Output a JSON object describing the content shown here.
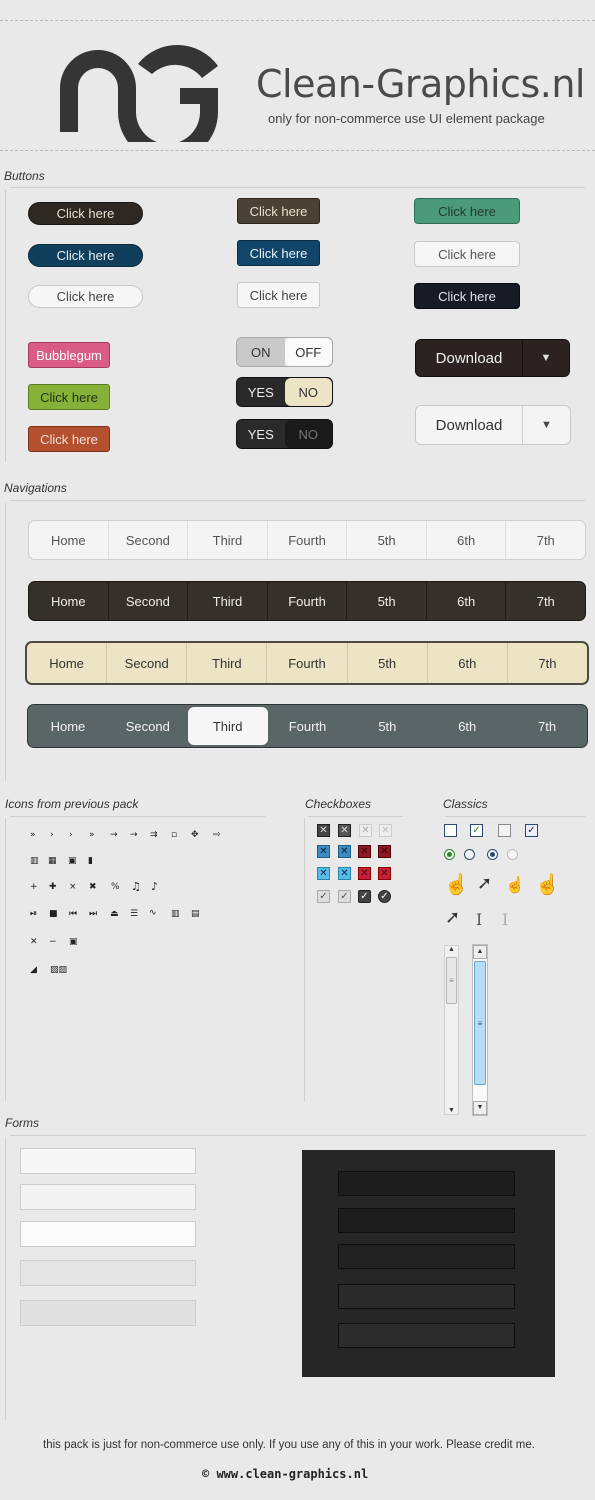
{
  "header": {
    "brand": "Clean-Graphics.nl",
    "tagline": "only for non-commerce use UI element package"
  },
  "sections": {
    "buttons": "Buttons",
    "navigations": "Navigations",
    "icons": "Icons from previous pack",
    "checkboxes": "Checkboxes",
    "classics": "Classics",
    "forms": "Forms"
  },
  "buttons": {
    "click": "Click here",
    "bubblegum": "Bubblegum",
    "on": "ON",
    "off": "OFF",
    "yes": "YES",
    "no": "NO",
    "download": "Download"
  },
  "nav": [
    "Home",
    "Second",
    "Third",
    "Fourth",
    "5th",
    "6th",
    "7th"
  ],
  "footer": {
    "notice": "this pack is just for non-commerce use only. If you use any of this in your work. Please credit me.",
    "credit": "© www.clean-graphics.nl"
  },
  "colors": {
    "dark_brown": "#2f2a25",
    "navy": "#14425e",
    "teal": "#4b9a7c",
    "bubblegum": "#d95b86",
    "green": "#86b23a",
    "rust": "#b4502f",
    "beige": "#ece4c5",
    "slate": "#5a6565"
  }
}
